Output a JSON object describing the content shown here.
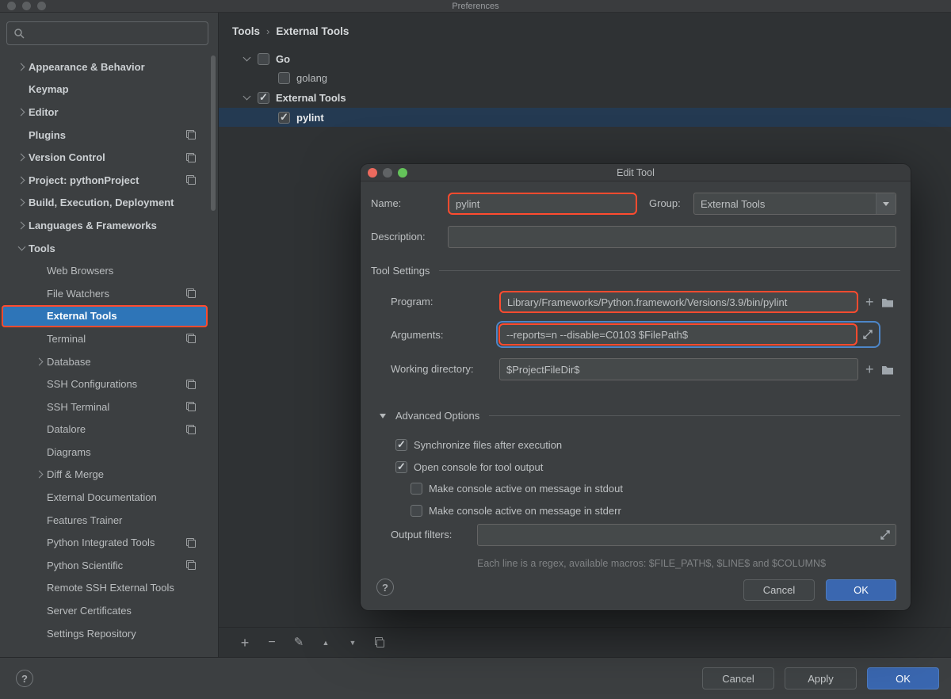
{
  "window": {
    "title": "Preferences"
  },
  "icons": {
    "plus": "+",
    "help": "?"
  },
  "colors": {
    "annotation": "#ff4b2f",
    "focus_ring": "#4d86c8",
    "sidebar_selection": "#2e75b8",
    "tree_selection": "#243a52",
    "primary_button": "#3a67b0"
  },
  "sidebar": {
    "search": {
      "placeholder": ""
    },
    "items": [
      {
        "label": "Appearance & Behavior",
        "level": 0,
        "bold": true,
        "chevron": "right",
        "copy_icon": false,
        "selected": false
      },
      {
        "label": "Keymap",
        "level": 0,
        "bold": true,
        "chevron": "",
        "copy_icon": false,
        "selected": false
      },
      {
        "label": "Editor",
        "level": 0,
        "bold": true,
        "chevron": "right",
        "copy_icon": false,
        "selected": false
      },
      {
        "label": "Plugins",
        "level": 0,
        "bold": true,
        "chevron": "",
        "copy_icon": true,
        "selected": false
      },
      {
        "label": "Version Control",
        "level": 0,
        "bold": true,
        "chevron": "right",
        "copy_icon": true,
        "selected": false
      },
      {
        "label": "Project: pythonProject",
        "level": 0,
        "bold": true,
        "chevron": "right",
        "copy_icon": true,
        "selected": false
      },
      {
        "label": "Build, Execution, Deployment",
        "level": 0,
        "bold": true,
        "chevron": "right",
        "copy_icon": false,
        "selected": false
      },
      {
        "label": "Languages & Frameworks",
        "level": 0,
        "bold": true,
        "chevron": "right",
        "copy_icon": false,
        "selected": false
      },
      {
        "label": "Tools",
        "level": 0,
        "bold": true,
        "chevron": "down",
        "copy_icon": false,
        "selected": false
      },
      {
        "label": "Web Browsers",
        "level": 1,
        "bold": false,
        "chevron": "",
        "copy_icon": false,
        "selected": false
      },
      {
        "label": "File Watchers",
        "level": 1,
        "bold": false,
        "chevron": "",
        "copy_icon": true,
        "selected": false
      },
      {
        "label": "External Tools",
        "level": 1,
        "bold": true,
        "chevron": "",
        "copy_icon": false,
        "selected": true
      },
      {
        "label": "Terminal",
        "level": 1,
        "bold": false,
        "chevron": "",
        "copy_icon": true,
        "selected": false
      },
      {
        "label": "Database",
        "level": 1,
        "bold": false,
        "chevron": "right",
        "copy_icon": false,
        "selected": false
      },
      {
        "label": "SSH Configurations",
        "level": 1,
        "bold": false,
        "chevron": "",
        "copy_icon": true,
        "selected": false
      },
      {
        "label": "SSH Terminal",
        "level": 1,
        "bold": false,
        "chevron": "",
        "copy_icon": true,
        "selected": false
      },
      {
        "label": "Datalore",
        "level": 1,
        "bold": false,
        "chevron": "",
        "copy_icon": true,
        "selected": false
      },
      {
        "label": "Diagrams",
        "level": 1,
        "bold": false,
        "chevron": "",
        "copy_icon": false,
        "selected": false
      },
      {
        "label": "Diff & Merge",
        "level": 1,
        "bold": false,
        "chevron": "right",
        "copy_icon": false,
        "selected": false
      },
      {
        "label": "External Documentation",
        "level": 1,
        "bold": false,
        "chevron": "",
        "copy_icon": false,
        "selected": false
      },
      {
        "label": "Features Trainer",
        "level": 1,
        "bold": false,
        "chevron": "",
        "copy_icon": false,
        "selected": false
      },
      {
        "label": "Python Integrated Tools",
        "level": 1,
        "bold": false,
        "chevron": "",
        "copy_icon": true,
        "selected": false
      },
      {
        "label": "Python Scientific",
        "level": 1,
        "bold": false,
        "chevron": "",
        "copy_icon": true,
        "selected": false
      },
      {
        "label": "Remote SSH External Tools",
        "level": 1,
        "bold": false,
        "chevron": "",
        "copy_icon": false,
        "selected": false
      },
      {
        "label": "Server Certificates",
        "level": 1,
        "bold": false,
        "chevron": "",
        "copy_icon": false,
        "selected": false
      },
      {
        "label": "Settings Repository",
        "level": 1,
        "bold": false,
        "chevron": "",
        "copy_icon": false,
        "selected": false
      }
    ]
  },
  "breadcrumb": {
    "items": [
      "Tools",
      "External Tools"
    ],
    "separator": "›"
  },
  "tools_tree": {
    "rows": [
      {
        "label": "Go",
        "level": 0,
        "checked": false,
        "bold": true,
        "selected": false
      },
      {
        "label": "golang",
        "level": 1,
        "checked": false,
        "bold": false,
        "selected": false
      },
      {
        "label": "External Tools",
        "level": 0,
        "checked": true,
        "bold": true,
        "selected": false
      },
      {
        "label": "pylint",
        "level": 1,
        "checked": true,
        "bold": true,
        "selected": true
      }
    ]
  },
  "tree_toolbar": {
    "icons": [
      {
        "name": "add",
        "glyph": "+"
      },
      {
        "name": "remove",
        "glyph": "−"
      },
      {
        "name": "edit",
        "glyph": "✎"
      },
      {
        "name": "move-up",
        "glyph": "▲"
      },
      {
        "name": "move-down",
        "glyph": "▼"
      },
      {
        "name": "copy",
        "glyph": ""
      }
    ]
  },
  "dialog": {
    "title": "Edit Tool",
    "fields": {
      "name": {
        "label": "Name:",
        "value": "pylint"
      },
      "group": {
        "label": "Group:",
        "value": "External Tools"
      },
      "description": {
        "label": "Description:",
        "value": ""
      },
      "program": {
        "label": "Program:",
        "value": "Library/Frameworks/Python.framework/Versions/3.9/bin/pylint"
      },
      "arguments": {
        "label": "Arguments:",
        "value": "--reports=n --disable=C0103 $FilePath$"
      },
      "working_directory": {
        "label": "Working directory:",
        "value": "$ProjectFileDir$"
      },
      "output_filters": {
        "label": "Output filters:",
        "value": ""
      }
    },
    "sections": {
      "tool_settings": "Tool Settings",
      "advanced_options": "Advanced Options"
    },
    "options": [
      {
        "label": "Synchronize files after execution",
        "checked": true,
        "indent": 0
      },
      {
        "label": "Open console for tool output",
        "checked": true,
        "indent": 0
      },
      {
        "label": "Make console active on message in stdout",
        "checked": false,
        "indent": 1
      },
      {
        "label": "Make console active on message in stderr",
        "checked": false,
        "indent": 1
      }
    ],
    "hint": "Each line is a regex, available macros: $FILE_PATH$, $LINE$ and $COLUMN$",
    "help": "?",
    "buttons": {
      "cancel": "Cancel",
      "ok": "OK"
    }
  },
  "footer": {
    "help": "?",
    "buttons": {
      "cancel": "Cancel",
      "apply": "Apply",
      "ok": "OK"
    }
  }
}
